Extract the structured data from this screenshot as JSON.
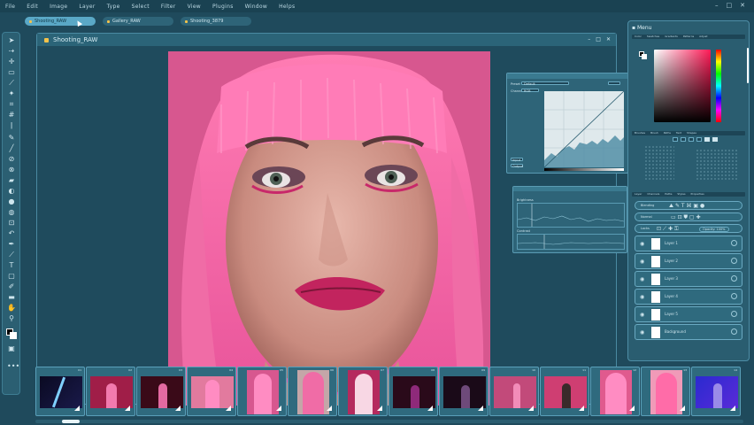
{
  "menubar": {
    "items": [
      "File",
      "Edit",
      "Image",
      "Layer",
      "Type",
      "Select",
      "Filter",
      "View",
      "Plugins",
      "Window",
      "Helps"
    ]
  },
  "window_controls": {
    "minimize": "–",
    "maximize": "□",
    "close": "✕"
  },
  "tabs": [
    {
      "label": "Shooting_RAW",
      "active": true
    },
    {
      "label": "Gallery_RAW",
      "active": false
    },
    {
      "label": "Shooting_3879",
      "active": false
    }
  ],
  "document": {
    "title": "Shooting_RAW",
    "controls": {
      "minimize": "–",
      "maximize": "□",
      "close": "✕"
    }
  },
  "curves_panel": {
    "channel_label": "Preset",
    "channel_value": "Default",
    "input_label": "Channel",
    "input_value": "RGB",
    "input_box": "Input",
    "output_box": "Output"
  },
  "histogram_panel": {
    "row1_label": "Brightness",
    "row2_label": "Contrast"
  },
  "right_panel": {
    "title": "Menu",
    "color_tabs": [
      "Color",
      "Swatches",
      "Gradients",
      "Patterns",
      "Adjust"
    ],
    "brush_tabs": [
      "Brushes",
      "Brush",
      "Paths",
      "Text",
      "Shapes"
    ],
    "layer_tabs": [
      "Layer",
      "Channels",
      "Paths",
      "Styles",
      "Properties"
    ],
    "blend_mode": "Blending",
    "normal": "Normal",
    "locks": "Locks",
    "opacity": "Opacity: 100%",
    "layers": [
      {
        "name": "Layer 1"
      },
      {
        "name": "Layer 2"
      },
      {
        "name": "Layer 3"
      },
      {
        "name": "Layer 4"
      },
      {
        "name": "Layer 5"
      },
      {
        "name": "Background"
      }
    ]
  },
  "filmstrip": {
    "thumbs": [
      "01",
      "02",
      "03",
      "04",
      "05",
      "06",
      "07",
      "08",
      "09",
      "10",
      "11",
      "12",
      "13",
      "14"
    ]
  },
  "colors": {
    "bg": "#1f4a5c",
    "panel": "#2e6478",
    "accent": "#5aa8c6",
    "hair": "#f06ca6",
    "lips": "#c2245e"
  }
}
